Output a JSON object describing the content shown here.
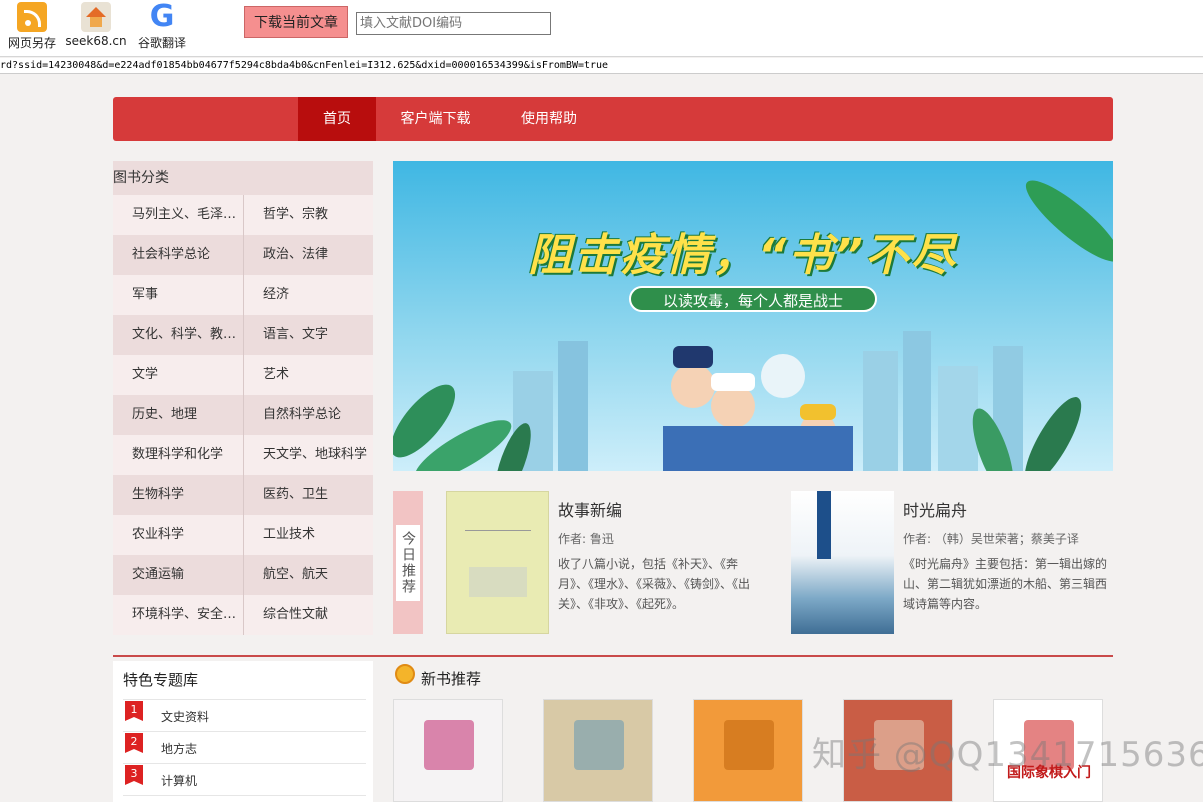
{
  "toolbar": {
    "items": [
      {
        "label": "网页另存",
        "icon": "rss-save-icon"
      },
      {
        "label": "seek68.cn",
        "icon": "home-icon"
      },
      {
        "label": "谷歌翻译",
        "icon": "google-icon"
      }
    ],
    "google_glyph": "G",
    "download_button": "下载当前文章",
    "doi_placeholder": "填入文献DOI编码"
  },
  "url_text": "rd?ssid=14230048&d=e224adf01854bb04677f5294c8bda4b0&cnFenlei=I312.625&dxid=000016534399&isFromBW=true",
  "nav": {
    "items": [
      "首页",
      "客户端下载",
      "使用帮助"
    ],
    "active_index": 0
  },
  "categories": {
    "title": "图书分类",
    "rows": [
      [
        "马列主义、毛泽东...",
        "哲学、宗教"
      ],
      [
        "社会科学总论",
        "政治、法律"
      ],
      [
        "军事",
        "经济"
      ],
      [
        "文化、科学、教育...",
        "语言、文字"
      ],
      [
        "文学",
        "艺术"
      ],
      [
        "历史、地理",
        "自然科学总论"
      ],
      [
        "数理科学和化学",
        "天文学、地球科学"
      ],
      [
        "生物科学",
        "医药、卫生"
      ],
      [
        "农业科学",
        "工业技术"
      ],
      [
        "交通运输",
        "航空、航天"
      ],
      [
        "环境科学、安全科...",
        "综合性文献"
      ]
    ]
  },
  "banner": {
    "headline": "阻击疫情，“书”不尽",
    "subline": "以读攻毒，每个人都是战士"
  },
  "today": {
    "tab_label": "今日推荐",
    "books": [
      {
        "title": "故事新编",
        "author": "作者: 鲁迅",
        "desc": "收了八篇小说，包括《补天》、《奔月》、《理水》、《采薇》、《铸剑》、《出关》、《非攻》、《起死》。"
      },
      {
        "title": "时光扁舟",
        "author": "作者: （韩）吴世荣著；蔡美子译",
        "desc": "《时光扁舟》主要包括：第一辑出嫁的山、第二辑犹如漂逝的木船、第三辑西域诗篇等内容。"
      }
    ]
  },
  "special": {
    "title": "特色专题库",
    "items": [
      {
        "num": "1",
        "label": "文史资料"
      },
      {
        "num": "2",
        "label": "地方志"
      },
      {
        "num": "3",
        "label": "计算机"
      }
    ]
  },
  "new_books": {
    "title": "新书推荐",
    "covers": [
      {
        "color": "#f5f3f4",
        "accent": "#c63a7a"
      },
      {
        "color": "#d8c9a6",
        "accent": "#6f9db3"
      },
      {
        "color": "#f29a3a",
        "accent": "#c46a10"
      },
      {
        "color": "#c95d45",
        "accent": "#e9cbb7"
      },
      {
        "color": "#ffffff",
        "accent": "#d23030"
      }
    ],
    "last_cover_text": "国际象棋入门"
  },
  "watermark": "知乎 @QQ1341715636",
  "colors": {
    "nav_bg": "#d63a3a",
    "nav_active": "#b80d0d",
    "accent_red": "#c94a4a"
  }
}
